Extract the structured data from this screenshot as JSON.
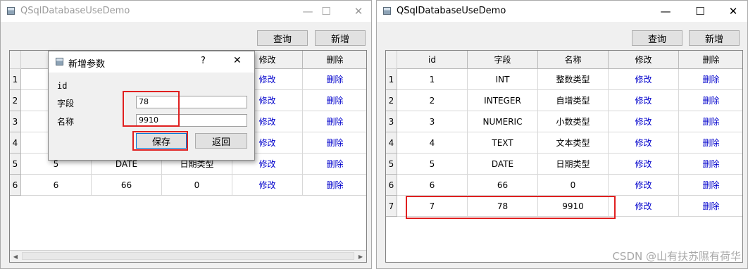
{
  "left_window": {
    "title": "QSqlDatabaseUseDemo",
    "controls": {
      "minimize": "—",
      "maximize": "☐",
      "close": "✕"
    },
    "toolbar": {
      "query_label": "查询",
      "add_label": "新增"
    },
    "table": {
      "headers": [
        "",
        "",
        "",
        "修改",
        "删除"
      ],
      "row_numbers": [
        "1",
        "2",
        "3",
        "4",
        "5",
        "6"
      ],
      "rows": [
        [
          "",
          "",
          "",
          "修改",
          "删除"
        ],
        [
          "",
          "",
          "",
          "修改",
          "删除"
        ],
        [
          "",
          "",
          "",
          "修改",
          "删除"
        ],
        [
          "",
          "",
          "",
          "修改",
          "删除"
        ],
        [
          "5",
          "DATE",
          "日期类型",
          "修改",
          "删除"
        ],
        [
          "6",
          "66",
          "0",
          "修改",
          "删除"
        ]
      ]
    },
    "dialog": {
      "title": "新增参数",
      "help": "?",
      "close": "✕",
      "id_label": "id",
      "field_label": "字段",
      "field_value": "78",
      "name_label": "名称",
      "name_value": "9910",
      "save_label": "保存",
      "back_label": "返回"
    }
  },
  "right_window": {
    "title": "QSqlDatabaseUseDemo",
    "controls": {
      "minimize": "—",
      "maximize": "☐",
      "close": "✕"
    },
    "toolbar": {
      "query_label": "查询",
      "add_label": "新增"
    },
    "table": {
      "headers": [
        "id",
        "字段",
        "名称",
        "修改",
        "删除"
      ],
      "row_numbers": [
        "1",
        "2",
        "3",
        "4",
        "5",
        "6",
        "7"
      ],
      "rows": [
        [
          "1",
          "INT",
          "整数类型",
          "修改",
          "删除"
        ],
        [
          "2",
          "INTEGER",
          "自增类型",
          "修改",
          "删除"
        ],
        [
          "3",
          "NUMERIC",
          "小数类型",
          "修改",
          "删除"
        ],
        [
          "4",
          "TEXT",
          "文本类型",
          "修改",
          "删除"
        ],
        [
          "5",
          "DATE",
          "日期类型",
          "修改",
          "删除"
        ],
        [
          "6",
          "66",
          "0",
          "修改",
          "删除"
        ],
        [
          "7",
          "78",
          "9910",
          "修改",
          "删除"
        ]
      ]
    }
  },
  "scroll_arrows": {
    "left": "◀",
    "right": "▶"
  },
  "watermark": "CSDN @山有扶苏隰有荷华",
  "colors": {
    "link": "#0000cc",
    "highlight": "#e02020",
    "window_bg": "#f0f0f0"
  }
}
